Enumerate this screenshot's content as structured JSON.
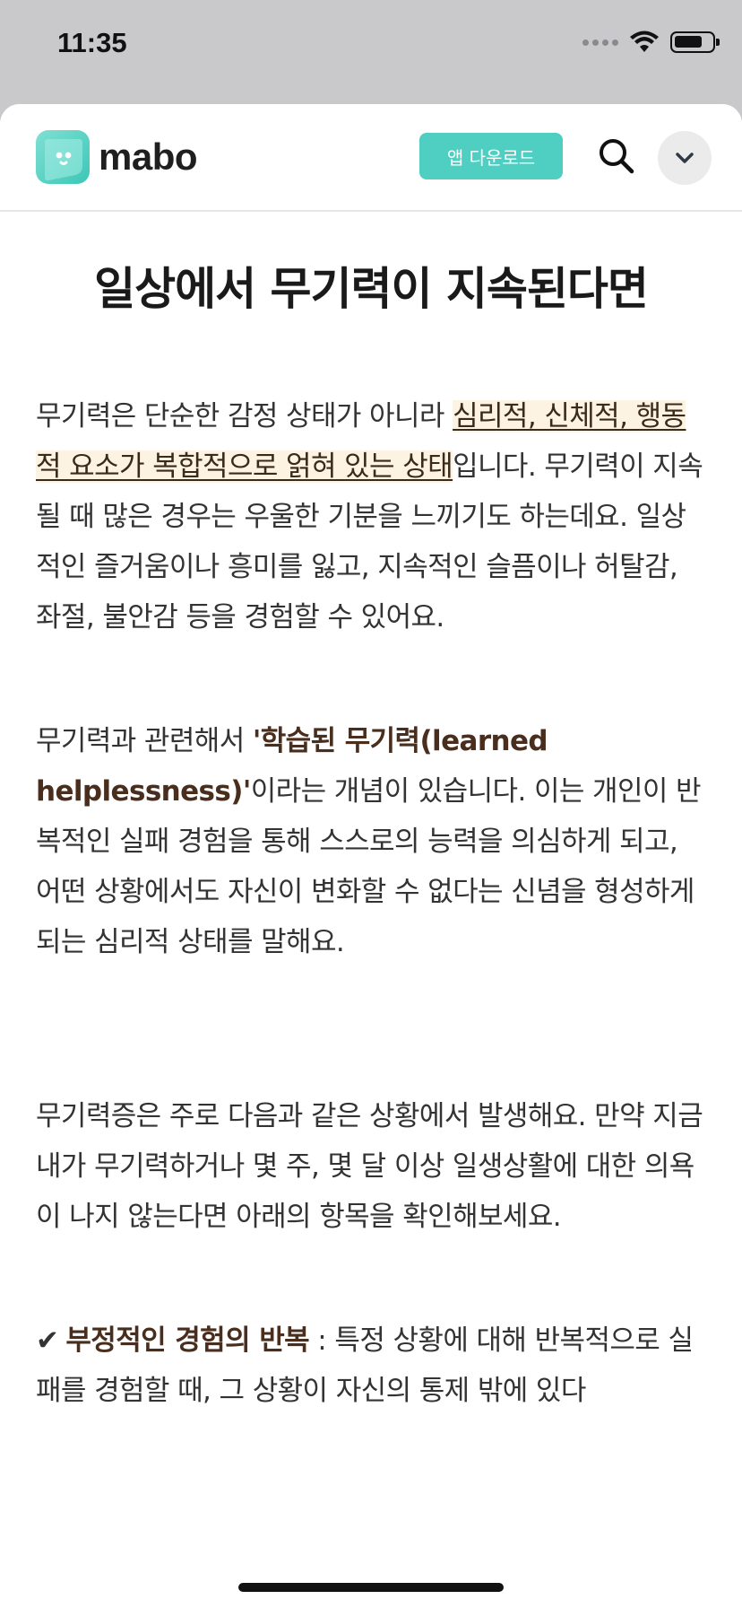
{
  "status_bar": {
    "time": "11:35"
  },
  "header": {
    "logo_text": "mabo",
    "download_label": "앱 다운로드"
  },
  "article": {
    "title": "일상에서 무기력이 지속된다면",
    "p1": {
      "before": "무기력은 단순한 감정 상태가 아니라 ",
      "highlight": "심리적, 신체적, 행동적 요소가 복합적으로 얽혀 있는 상태",
      "after": "입니다. 무기력이 지속될 때 많은 경우는 우울한 기분을 느끼기도 하는데요. 일상적인 즐거움이나 흥미를 잃고, 지속적인 슬픔이나 허탈감, 좌절, 불안감 등을 경험할 수 있어요."
    },
    "p2": {
      "before": "무기력과 관련해서 ",
      "term": "'학습된 무기력(learned helplessness)'",
      "after": "이라는 개념이 있습니다. 이는 개인이 반복적인 실패 경험을 통해 스스로의 능력을 의심하게 되고, 어떤 상황에서도 자신이 변화할 수 없다는 신념을 형성하게 되는 심리적 상태를 말해요."
    },
    "p3": "무기력증은 주로 다음과 같은 상황에서 발생해요. 만약 지금 내가 무기력하거나 몇 주, 몇 달 이상 일생상활에 대한 의욕이 나지 않는다면 아래의 항목을 확인해보세요.",
    "p4": {
      "check": "✔",
      "term": "부정적인 경험의 반복",
      "after": " : 특정 상황에 대해 반복적으로 실패를 경험할 때, 그 상황이 자신의 통제 밖에 있다"
    }
  },
  "colors": {
    "accent": "#4fcfc2",
    "highlight_bg": "#fdf3e3",
    "term": "#4a2e1d"
  }
}
